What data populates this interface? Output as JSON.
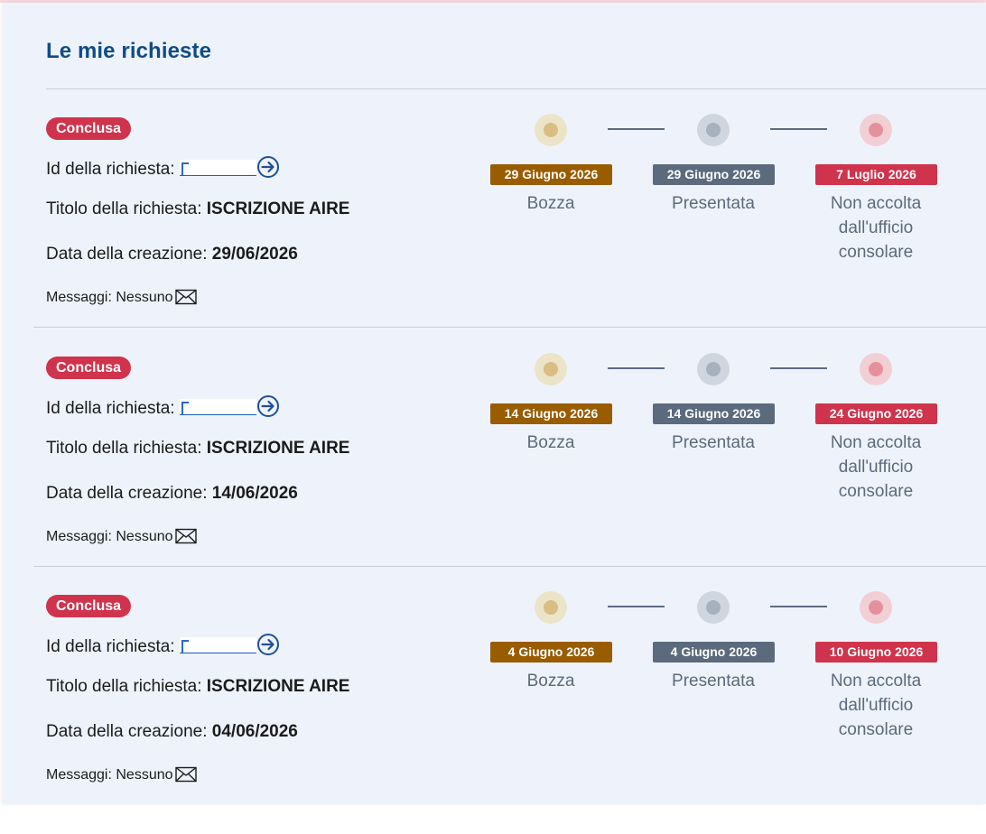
{
  "page": {
    "title": "Le mie richieste"
  },
  "labels": {
    "id_prefix": "Id della richiesta:",
    "title_prefix": "Titolo della richiesta:",
    "created_prefix": "Data della creazione:",
    "messages_prefix": "Messaggi:"
  },
  "icons": {
    "open_request": "arrow-right-circle-icon",
    "messages": "envelope-icon"
  },
  "colors": {
    "title": "#0e4c8a",
    "status_concluded": "#d0334c",
    "step_bozza": "#995c00",
    "step_presentata": "#5b6a7d",
    "step_non_accolta": "#d0334c",
    "link": "#1a63c3"
  },
  "requests": [
    {
      "status": "Conclusa",
      "request_title": "ISCRIZIONE AIRE",
      "created_date": "29/06/2026",
      "messages": "Nessuno",
      "steps": [
        {
          "date": "29 Giugno 2026",
          "label": "Bozza"
        },
        {
          "date": "29 Giugno 2026",
          "label": "Presentata"
        },
        {
          "date": "7 Luglio 2026",
          "label": "Non accolta dall'ufficio consolare"
        }
      ]
    },
    {
      "status": "Conclusa",
      "request_title": "ISCRIZIONE AIRE",
      "created_date": "14/06/2026",
      "messages": "Nessuno",
      "steps": [
        {
          "date": "14 Giugno 2026",
          "label": "Bozza"
        },
        {
          "date": "14 Giugno 2026",
          "label": "Presentata"
        },
        {
          "date": "24 Giugno 2026",
          "label": "Non accolta dall'ufficio consolare"
        }
      ]
    },
    {
      "status": "Conclusa",
      "request_title": "ISCRIZIONE AIRE",
      "created_date": "04/06/2026",
      "messages": "Nessuno",
      "steps": [
        {
          "date": "4 Giugno 2026",
          "label": "Bozza"
        },
        {
          "date": "4 Giugno 2026",
          "label": "Presentata"
        },
        {
          "date": "10 Giugno 2026",
          "label": "Non accolta dall'ufficio consolare"
        }
      ]
    }
  ]
}
